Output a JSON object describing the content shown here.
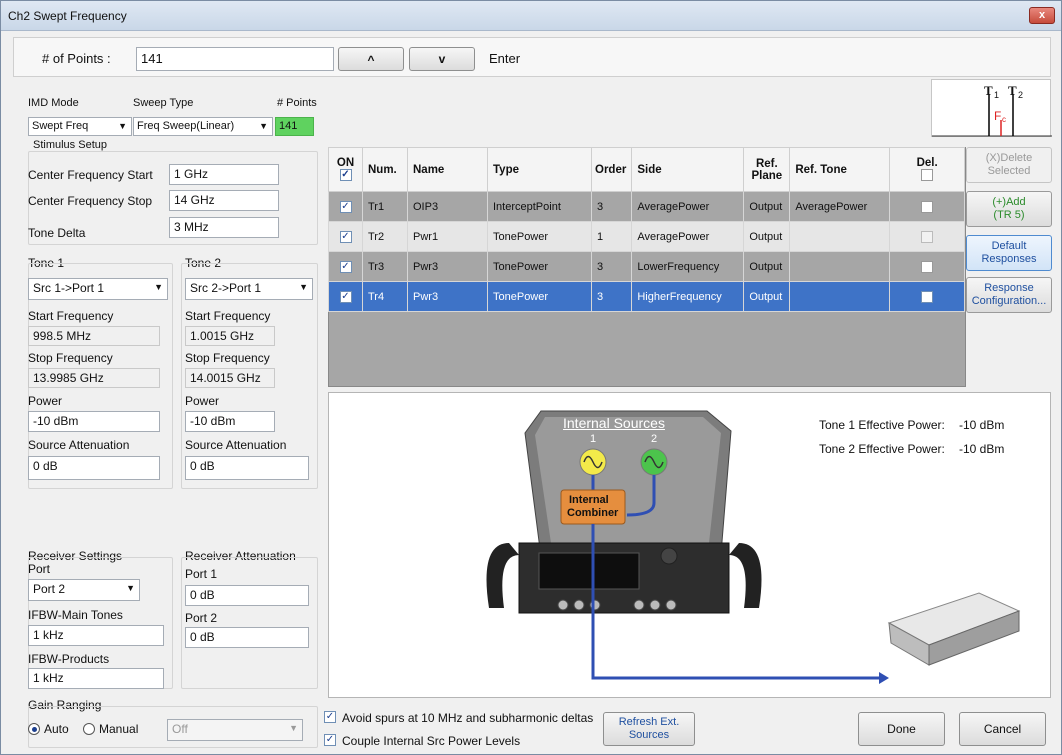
{
  "window": {
    "title": "Ch2 Swept Frequency",
    "close": "x"
  },
  "toolbar": {
    "points_label": "# of Points  :",
    "points_value": "141",
    "up": "^",
    "down": "v",
    "enter": "Enter"
  },
  "marker": {
    "t1": "T",
    "t1sub": "1",
    "t2": "T",
    "t2sub": "2",
    "fc": "F",
    "fcsub": "c"
  },
  "imd": {
    "mode_label": "IMD Mode",
    "mode_value": "Swept Freq",
    "sweep_label": "Sweep Type",
    "sweep_value": "Freq Sweep(Linear)",
    "points_label": "# Points",
    "points_value": "141"
  },
  "stimulus": {
    "label": "Stimulus Setup",
    "cf_start_label": "Center Frequency Start",
    "cf_start": "1 GHz",
    "cf_stop_label": "Center Frequency Stop",
    "cf_stop": "14 GHz",
    "tone_delta_label": "Tone Delta",
    "tone_delta": "3 MHz"
  },
  "tone1": {
    "label": "Tone 1",
    "src": "Src 1->Port 1",
    "start_label": "Start Frequency",
    "start": "998.5 MHz",
    "stop_label": "Stop Frequency",
    "stop": "13.9985 GHz",
    "power_label": "Power",
    "power": "-10 dBm",
    "atten_label": "Source Attenuation",
    "atten": "0 dB"
  },
  "tone2": {
    "label": "Tone 2",
    "src": "Src 2->Port 1",
    "start_label": "Start Frequency",
    "start": "1.0015 GHz",
    "stop_label": "Stop Frequency",
    "stop": "14.0015 GHz",
    "power_label": "Power",
    "power": "-10 dBm",
    "atten_label": "Source Attenuation",
    "atten": "0 dB"
  },
  "receiver": {
    "label": "Receiver Settings",
    "port_label": "Port",
    "port": "Port 2",
    "ifbw_main_label": "IFBW-Main Tones",
    "ifbw_main": "1 kHz",
    "ifbw_prod_label": "IFBW-Products",
    "ifbw_prod": "1 kHz"
  },
  "atten": {
    "label": "Receiver Attenuation",
    "p1_label": "Port 1",
    "p1": "0 dB",
    "p2_label": "Port 2",
    "p2": "0 dB"
  },
  "gain": {
    "label": "Gain Ranging",
    "auto": "Auto",
    "manual": "Manual",
    "value": "Off"
  },
  "table": {
    "headers": {
      "on": "ON",
      "num": "Num.",
      "name": "Name",
      "type": "Type",
      "order": "Order",
      "side": "Side",
      "ref_plane_1": "Ref.",
      "ref_plane_2": "Plane",
      "ref_tone": "Ref. Tone",
      "del": "Del."
    },
    "rows": [
      {
        "num": "Tr1",
        "name": "OIP3",
        "type": "InterceptPoint",
        "order": "3",
        "side": "AveragePower",
        "plane": "Output",
        "tone": "AveragePower"
      },
      {
        "num": "Tr2",
        "name": "Pwr1",
        "type": "TonePower",
        "order": "1",
        "side": "AveragePower",
        "plane": "Output",
        "tone": ""
      },
      {
        "num": "Tr3",
        "name": "Pwr3",
        "type": "TonePower",
        "order": "3",
        "side": "LowerFrequency",
        "plane": "Output",
        "tone": ""
      },
      {
        "num": "Tr4",
        "name": "Pwr3",
        "type": "TonePower",
        "order": "3",
        "side": "HigherFrequency",
        "plane": "Output",
        "tone": ""
      }
    ]
  },
  "side_buttons": {
    "delete_1": "(X)Delete",
    "delete_2": "Selected",
    "add_1": "(+)Add",
    "add_2": "(TR 5)",
    "default_1": "Default",
    "default_2": "Responses",
    "config_1": "Response",
    "config_2": "Configuration..."
  },
  "diagram": {
    "title": "Internal Sources",
    "src1": "1",
    "src2": "2",
    "combiner_1": "Internal",
    "combiner_2": "Combiner",
    "t1_power_label": "Tone 1 Effective Power:",
    "t1_power": "-10 dBm",
    "t2_power_label": "Tone 2 Effective Power:",
    "t2_power": "-10 dBm"
  },
  "options": {
    "avoid_spurs": "Avoid spurs at 10 MHz and subharmonic deltas",
    "couple": "Couple Internal Src Power Levels"
  },
  "buttons": {
    "refresh_1": "Refresh Ext.",
    "refresh_2": "Sources",
    "done": "Done",
    "cancel": "Cancel"
  },
  "colors": {
    "accent_blue": "#3e73c7",
    "green_field": "#5fd25f",
    "diagram_wire": "#2f4fb3",
    "combiner": "#e58e3e"
  }
}
